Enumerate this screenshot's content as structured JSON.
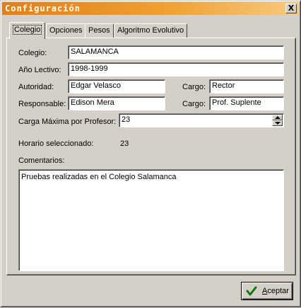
{
  "window": {
    "title": "Configuración",
    "close_label": "X",
    "accent_color": "#e08018"
  },
  "tabs": [
    {
      "label": "Colegio",
      "active": true
    },
    {
      "label": "Opciones",
      "active": false
    },
    {
      "label": "Pesos",
      "active": false
    },
    {
      "label": "Algoritmo Evolutivo",
      "active": false
    }
  ],
  "form": {
    "colegio_label": "Colegio:",
    "colegio_value": "SALAMANCA",
    "anio_label": "Año Lectivo:",
    "anio_value": "1998-1999",
    "autoridad_label": "Autoridad:",
    "autoridad_value": "Edgar Velasco",
    "cargo1_label": "Cargo:",
    "cargo1_value": "Rector",
    "responsable_label": "Responsable:",
    "responsable_value": "Edison Mera",
    "cargo2_label": "Cargo:",
    "cargo2_value": "Prof. Suplente",
    "carga_label": "Carga Máxima por Profesor:",
    "carga_value": "23",
    "horario_label": "Horario seleccionado:",
    "horario_value": "23",
    "comentarios_label": "Comentarios:",
    "comentarios_value": "Pruebas realizadas en el Colegio Salamanca"
  },
  "buttons": {
    "ok_prefix": "",
    "ok_underlined": "A",
    "ok_rest": "ceptar",
    "ok_icon": "checkmark-icon"
  }
}
